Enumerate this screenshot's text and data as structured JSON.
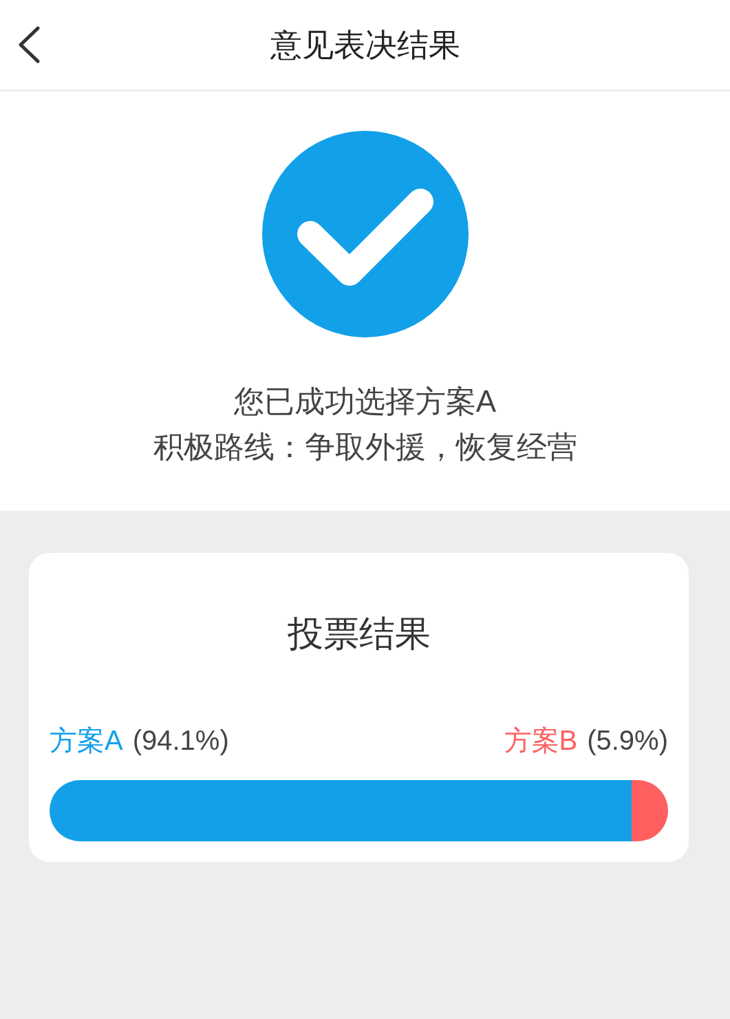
{
  "header": {
    "title": "意见表决结果"
  },
  "result": {
    "message": "您已成功选择方案A",
    "detail": "积极路线：争取外援，恢复经营"
  },
  "vote": {
    "title": "投票结果",
    "options": [
      {
        "name": "方案A",
        "percent": "(94.1%)",
        "color": "#13a0e9",
        "level": 0.941
      },
      {
        "name": "方案B",
        "percent": "(5.9%)",
        "color": "#ff5f5f",
        "level": 0.059
      }
    ]
  }
}
